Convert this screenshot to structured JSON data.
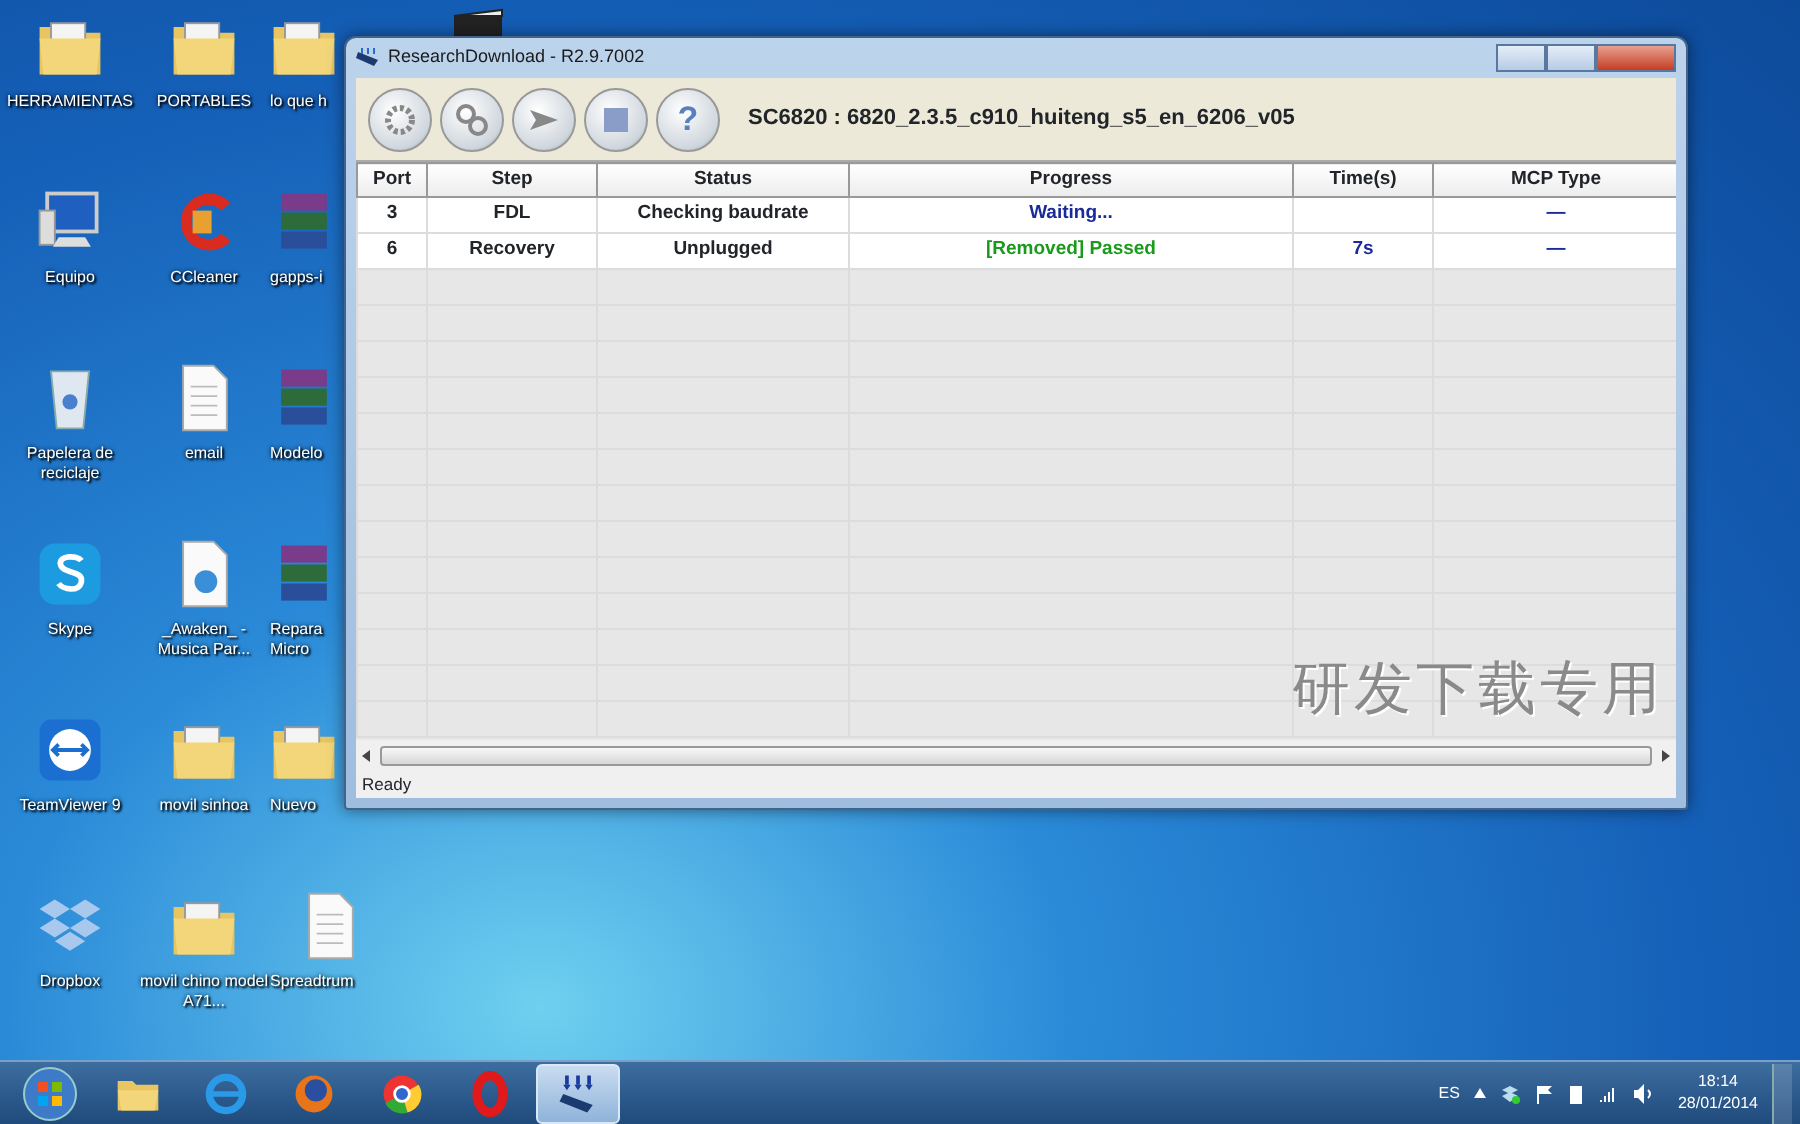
{
  "desktop_icons": [
    {
      "label": "HERRAMIENTAS",
      "kind": "folder"
    },
    {
      "label": "PORTABLES",
      "kind": "folder"
    },
    {
      "label": "lo que h",
      "kind": "folder"
    },
    {
      "label": "Equipo",
      "kind": "computer"
    },
    {
      "label": "CCleaner",
      "kind": "cleaner"
    },
    {
      "label": "gapps-i",
      "kind": "archive"
    },
    {
      "label": "Papelera de reciclaje",
      "kind": "recycle"
    },
    {
      "label": "email",
      "kind": "document"
    },
    {
      "label": "Modelo",
      "kind": "archive"
    },
    {
      "label": "Skype",
      "kind": "skype"
    },
    {
      "label": "_Awaken_ - Musica Par...",
      "kind": "audio"
    },
    {
      "label": "Repara Micro",
      "kind": "archive"
    },
    {
      "label": "TeamViewer 9",
      "kind": "teamviewer"
    },
    {
      "label": "movil sinhoa",
      "kind": "folder"
    },
    {
      "label": "Nuevo",
      "kind": "folder"
    },
    {
      "label": "Dropbox",
      "kind": "dropbox"
    },
    {
      "label": "movil chino model A71...",
      "kind": "folder"
    },
    {
      "label": "Spreadtrum",
      "kind": "document"
    }
  ],
  "window": {
    "title": "ResearchDownload - R2.9.7002",
    "toolbar": [
      {
        "kind": "settings"
      },
      {
        "kind": "advanced-settings"
      },
      {
        "kind": "start"
      },
      {
        "kind": "stop"
      },
      {
        "kind": "help",
        "glyph": "?"
      }
    ],
    "firmware_label": "SC6820 : 6820_2.3.5_c910_huiteng_s5_en_6206_v05",
    "table": {
      "columns": [
        "Port",
        "Step",
        "Status",
        "Progress",
        "Time(s)",
        "MCP Type"
      ],
      "rows": [
        {
          "port": "3",
          "step": "FDL",
          "status": "Checking baudrate",
          "progress": "Waiting...",
          "kind": "waiting",
          "mcp_type": "—"
        },
        {
          "port": "6",
          "step": "Recovery",
          "status": "Unplugged",
          "progress": "[Removed] Passed",
          "kind": "passed",
          "time": "7s",
          "mcp_type": "—"
        }
      ]
    },
    "background_text": "研发下载专用",
    "status_bar": "Ready"
  },
  "taskbar": {
    "apps": [
      {
        "kind": "explorer",
        "selected": false
      },
      {
        "kind": "ie",
        "selected": false
      },
      {
        "kind": "firefox",
        "selected": false
      },
      {
        "kind": "chrome",
        "selected": false
      },
      {
        "kind": "opera",
        "selected": false
      },
      {
        "kind": "download",
        "selected": true
      }
    ],
    "language": "ES",
    "time": "18:14",
    "date": "28/01/2014"
  }
}
